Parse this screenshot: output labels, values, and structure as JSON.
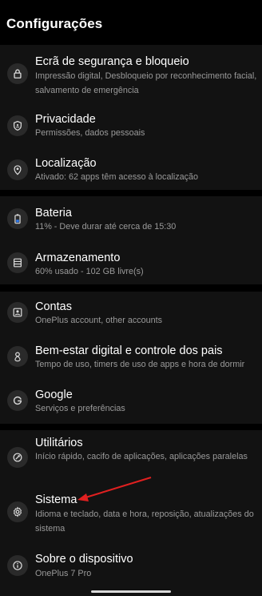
{
  "page_title": "Configurações",
  "groups": [
    {
      "items": [
        {
          "title": "Ecrã de segurança e bloqueio",
          "subtitle": "Impressão digital, Desbloqueio por reconhecimento facial, salvamento de emergência",
          "icon": "lock-icon"
        },
        {
          "title": "Privacidade",
          "subtitle": "Permissões, dados pessoais",
          "icon": "shield-icon"
        },
        {
          "title": "Localização",
          "subtitle": "Ativado: 62 apps têm acesso à localização",
          "icon": "location-pin-icon"
        }
      ]
    },
    {
      "items": [
        {
          "title": "Bateria",
          "subtitle": "11% - Deve durar até cerca de 15:30",
          "icon": "battery-icon"
        },
        {
          "title": "Armazenamento",
          "subtitle": "60% usado - 102 GB livre(s)",
          "icon": "storage-icon"
        }
      ]
    },
    {
      "items": [
        {
          "title": "Contas",
          "subtitle": "OnePlus account, other accounts",
          "icon": "account-icon"
        },
        {
          "title": "Bem-estar digital e controle dos pais",
          "subtitle": "Tempo de uso, timers de uso de apps e hora de dormir",
          "icon": "wellbeing-icon"
        },
        {
          "title": "Google",
          "subtitle": "Serviços e preferências",
          "icon": "google-icon"
        }
      ]
    },
    {
      "items": [
        {
          "title": "Utilitários",
          "subtitle": "Início rápido, cacifo de aplicações, aplicações paralelas",
          "icon": "utilities-icon"
        },
        {
          "title": "Sistema",
          "subtitle": "Idioma e teclado, data e hora, reposição, atualizações do sistema",
          "icon": "gear-icon"
        },
        {
          "title": "Sobre o dispositivo",
          "subtitle": "OnePlus 7 Pro",
          "icon": "info-icon"
        }
      ]
    }
  ],
  "colors": {
    "background": "#000000",
    "card": "#121212",
    "icon_circle": "#2a2a2a",
    "title": "#ffffff",
    "subtitle": "#9a9a9a",
    "arrow": "#e02020"
  }
}
